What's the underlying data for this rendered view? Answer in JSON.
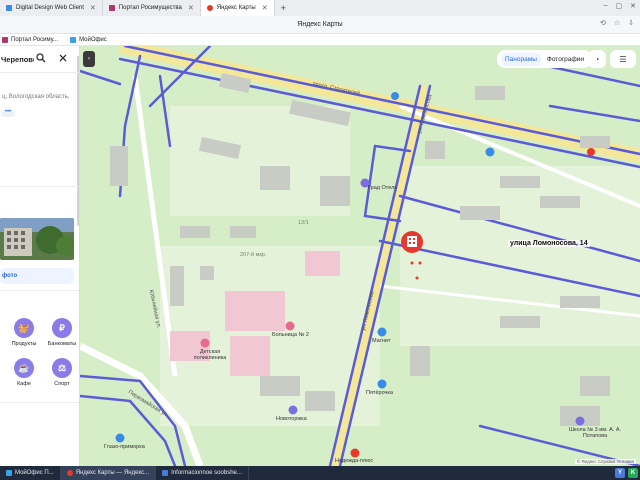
{
  "browser": {
    "tabs": [
      {
        "label": "Digital Design Web Client",
        "active": false
      },
      {
        "label": "Портал Росимущества",
        "active": false
      },
      {
        "label": "Яндекс Карты",
        "active": true
      }
    ],
    "window_title": "Яндекс Карты",
    "bookmarks": [
      "Портал Росиму...",
      "МойОфис"
    ]
  },
  "panel": {
    "search_value": "Череповец",
    "address": "ц, Вологодская область,",
    "more_label": "•••",
    "photos_label": "фото",
    "categories": [
      {
        "label": "Продукты",
        "icon": "shopping-basket-icon",
        "glyph": "🧺"
      },
      {
        "label": "Банкоматы",
        "icon": "ruble-icon",
        "glyph": "₽"
      },
      {
        "label": "Кафе",
        "icon": "coffee-cup-icon",
        "glyph": "☕"
      },
      {
        "label": "Спорт",
        "icon": "dumbbell-icon",
        "glyph": "⚖"
      }
    ]
  },
  "map": {
    "tabs": [
      "Панорамы",
      "Фотографии"
    ],
    "active_tab": "Панорамы",
    "pin_label": "улица Ломоносова, 14",
    "streets": [
      "просп. Строителей",
      "ул. Ломоносова",
      "ул. Ломоносова",
      "Юбилейная ул.",
      "Первомайская ул."
    ],
    "pois": [
      "Град Отель",
      "Больница № 2",
      "Детская поликлиника",
      "Магнит",
      "Пятёрочка",
      "Новоторжка",
      "Глазо-приморка",
      "Школа № 3 им. А. А. Потапова",
      "Надежда-плюс",
      "207-й мкр.",
      "13/1"
    ],
    "attribution": "© Яндекс  Справка  Условия"
  },
  "taskbar": {
    "tasks": [
      "МойОфис П...",
      "Яндекс Карты — Яндекс...",
      "Informacionnoe soobshe..."
    ],
    "tray": [
      {
        "label": "Y",
        "color": "#4a7bd6"
      },
      {
        "label": "K",
        "color": "#2aa65a"
      }
    ]
  },
  "colors": {
    "map_bg": "#d6eec8",
    "road_major": "#f3e79a",
    "road_minor": "#ffffff",
    "transit_line": "#5b5bd6",
    "building": "#c9ccc4",
    "hospital": "#f2c7d4",
    "pin": "#e8382e",
    "accent": "#2b6bd6",
    "category_circle": "#8b7be8"
  }
}
